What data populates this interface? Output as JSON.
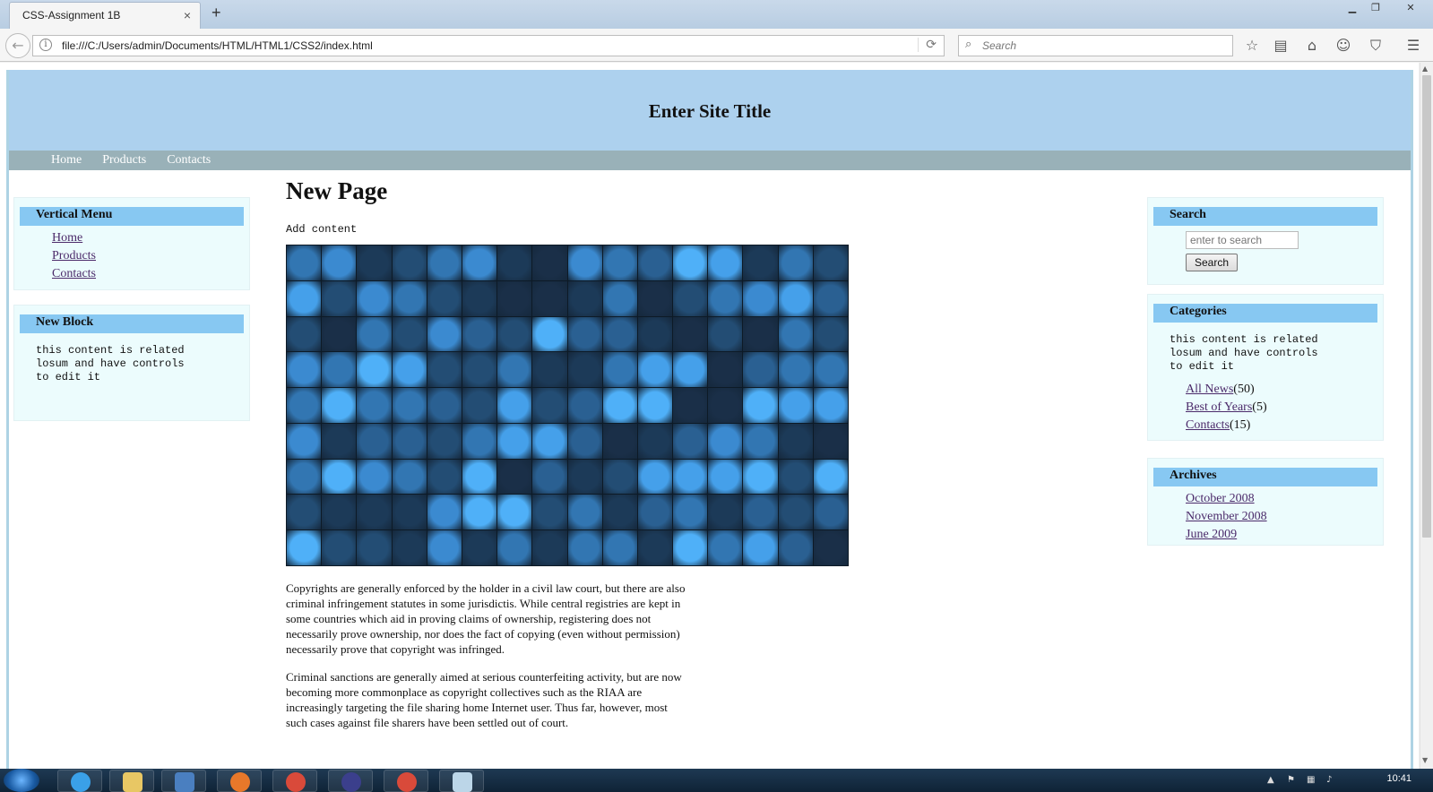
{
  "browser": {
    "tab_title": "CSS-Assignment 1B",
    "tab_close": "×",
    "new_tab": "+",
    "url": "file:///C:/Users/admin/Documents/HTML/HTML1/CSS2/index.html",
    "search_placeholder": "Search",
    "icons": [
      "info-icon",
      "reload-icon",
      "search-icon",
      "bookmark-star-icon",
      "reading-list-icon",
      "home-icon",
      "chat-icon",
      "pocket-icon",
      "menu-icon"
    ],
    "window_controls": [
      "minimize",
      "restore",
      "close"
    ]
  },
  "site": {
    "title": "Enter Site Title",
    "nav": [
      "Home",
      "Products",
      "Contacts"
    ]
  },
  "left": {
    "vertical_menu": {
      "title": "Vertical Menu",
      "items": [
        "Home",
        "Products",
        "Contacts"
      ]
    },
    "new_block": {
      "title": "New Block",
      "text": "this content is related\nlosum and have controls\nto edit it"
    }
  },
  "main": {
    "heading": "New Page",
    "intro": "Add content",
    "paragraphs": [
      "Copyrights are generally enforced by the holder in a civil law court, but there are also criminal infringement statutes in some jurisdictis. While central registries are kept in some countries which aid in proving claims of ownership, registering does not necessarily prove ownership, nor does the fact of copying (even without permission) necessarily prove that copyright was infringed.",
      "Criminal sanctions are generally aimed at serious counterfeiting activity, but are now becoming more commonplace as copyright collectives such as the RIAA are increasingly targeting the file sharing home Internet user. Thus far, however, most such cases against file sharers have been settled out of court."
    ]
  },
  "right": {
    "search": {
      "title": "Search",
      "placeholder": "enter to search",
      "button": "Search"
    },
    "categories": {
      "title": "Categories",
      "text": "this content is related\nlosum and have controls\nto edit it",
      "items": [
        {
          "label": "All News",
          "count": "(50)"
        },
        {
          "label": "Best of Years",
          "count": "(5)"
        },
        {
          "label": "Contacts",
          "count": "(15)"
        }
      ]
    },
    "archives": {
      "title": "Archives",
      "items": [
        "October 2008",
        "November 2008",
        "June 2009"
      ]
    }
  },
  "taskbar": {
    "clock": "10:41"
  },
  "colors": {
    "header_bg": "#add1ee",
    "nav_bg": "#99b1b8",
    "block_title_bg": "#87c8f2",
    "link": "#4b2a6a"
  }
}
